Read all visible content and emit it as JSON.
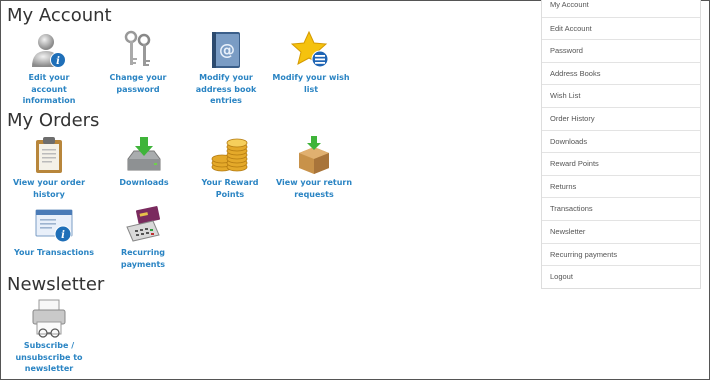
{
  "sections": {
    "account_title": "My Account",
    "orders_title": "My Orders",
    "newsletter_title": "Newsletter"
  },
  "account": {
    "edit_account": "Edit your account information",
    "change_password": "Change your password",
    "address_book": "Modify your address book entries",
    "wish_list": "Modify your wish list"
  },
  "orders": {
    "order_history": "View your order history",
    "downloads": "Downloads",
    "reward_points": "Your Reward Points",
    "returns": "View your return requests",
    "transactions": "Your Transactions",
    "recurring": "Recurring payments"
  },
  "newsletter": {
    "subscribe": "Subscribe / unsubscribe to newsletter"
  },
  "sidebar": {
    "items": [
      {
        "label": "My Account"
      },
      {
        "label": "Edit Account"
      },
      {
        "label": "Password"
      },
      {
        "label": "Address Books"
      },
      {
        "label": "Wish List"
      },
      {
        "label": "Order History"
      },
      {
        "label": "Downloads"
      },
      {
        "label": "Reward Points"
      },
      {
        "label": "Returns"
      },
      {
        "label": "Transactions"
      },
      {
        "label": "Newsletter"
      },
      {
        "label": "Recurring payments"
      },
      {
        "label": "Logout"
      }
    ]
  },
  "icons": {
    "edit_account": "user-info-icon",
    "change_password": "keys-icon",
    "address_book": "address-book-icon",
    "wish_list": "star-list-icon",
    "order_history": "clipboard-icon",
    "downloads": "download-tray-icon",
    "reward_points": "coins-icon",
    "returns": "box-return-icon",
    "transactions": "transactions-icon",
    "recurring": "cash-register-icon",
    "newsletter": "newsletter-printer-icon"
  },
  "colors": {
    "link": "#2a84c3",
    "text": "#333333",
    "sidebar_text": "#555555",
    "border": "#dddddd"
  }
}
